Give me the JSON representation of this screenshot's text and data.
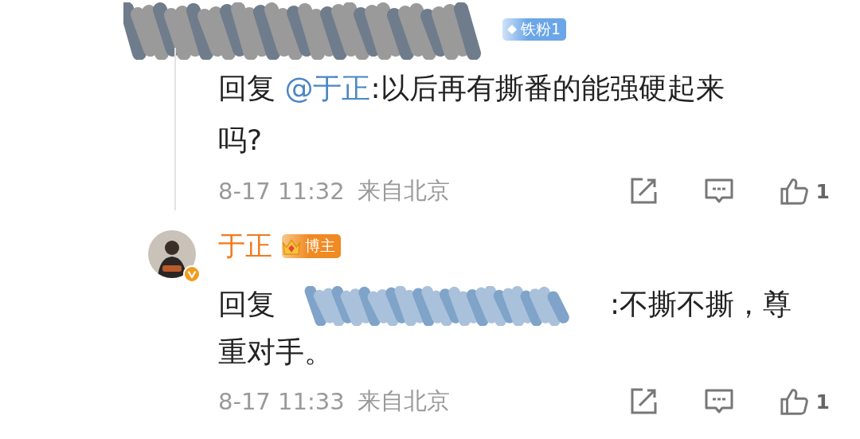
{
  "comments": [
    {
      "author_redacted": true,
      "badge": {
        "kind": "fan",
        "label": "铁粉1"
      },
      "reply_prefix": "回复",
      "mention": "@于正",
      "text": ":以后再有撕番的能强硬起来吗?",
      "time": "8-17 11:32",
      "location": "来自北京",
      "likes": "1",
      "thread_line": true
    },
    {
      "author": "于正",
      "verified": true,
      "badge": {
        "kind": "blogger",
        "label": "博主"
      },
      "reply_prefix": "回复",
      "target_redacted": true,
      "text": ":不撕不撕，尊重对手。",
      "time": "8-17 11:33",
      "location": "来自北京",
      "likes": "1",
      "thread_line": false
    }
  ]
}
